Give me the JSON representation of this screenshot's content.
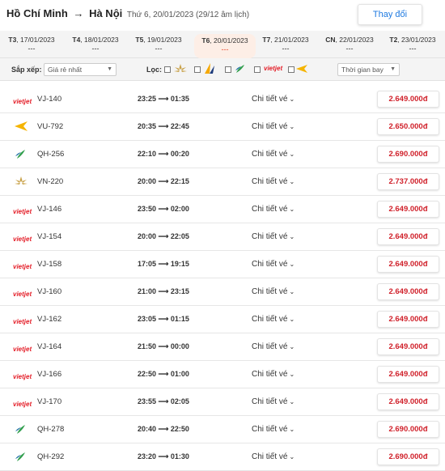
{
  "header": {
    "origin": "Hồ Chí Minh",
    "arrow": "→",
    "destination": "Hà Nội",
    "date_text": "Thứ 6, 20/01/2023 (29/12 âm lịch)",
    "change_button": "Thay đổi"
  },
  "days": [
    {
      "dow": "T3",
      "date": ", 17/01/2023",
      "price": "---",
      "active": false
    },
    {
      "dow": "T4",
      "date": ", 18/01/2023",
      "price": "---",
      "active": false
    },
    {
      "dow": "T5",
      "date": ", 19/01/2023",
      "price": "---",
      "active": false
    },
    {
      "dow": "T6",
      "date": ", 20/01/2023",
      "price": "---",
      "active": true
    },
    {
      "dow": "T7",
      "date": ", 21/01/2023",
      "price": "---",
      "active": false
    },
    {
      "dow": "CN",
      "date": ", 22/01/2023",
      "price": "---",
      "active": false
    },
    {
      "dow": "T2",
      "date": ", 23/01/2023",
      "price": "---",
      "active": false
    }
  ],
  "filters": {
    "sort_label": "Sắp xếp:",
    "sort_value": "Giá rẻ nhất",
    "filter_label": "Lọc:",
    "time_value": "Thời gian bay",
    "vietjet_logo_text": "vietjet"
  },
  "detail_label": "Chi tiết vé",
  "flights": [
    {
      "airline": "vietjet",
      "code": "VJ-140",
      "time": "23:25 ⟶ 01:35",
      "price": "2.649.000đ"
    },
    {
      "airline": "vietravel",
      "code": "VU-792",
      "time": "20:35 ⟶ 22:45",
      "price": "2.650.000đ"
    },
    {
      "airline": "bamboo",
      "code": "QH-256",
      "time": "22:10 ⟶ 00:20",
      "price": "2.690.000đ"
    },
    {
      "airline": "vietnam",
      "code": "VN-220",
      "time": "20:00 ⟶ 22:15",
      "price": "2.737.000đ"
    },
    {
      "airline": "vietjet",
      "code": "VJ-146",
      "time": "23:50 ⟶ 02:00",
      "price": "2.649.000đ"
    },
    {
      "airline": "vietjet",
      "code": "VJ-154",
      "time": "20:00 ⟶ 22:05",
      "price": "2.649.000đ"
    },
    {
      "airline": "vietjet",
      "code": "VJ-158",
      "time": "17:05 ⟶ 19:15",
      "price": "2.649.000đ"
    },
    {
      "airline": "vietjet",
      "code": "VJ-160",
      "time": "21:00 ⟶ 23:15",
      "price": "2.649.000đ"
    },
    {
      "airline": "vietjet",
      "code": "VJ-162",
      "time": "23:05 ⟶ 01:15",
      "price": "2.649.000đ"
    },
    {
      "airline": "vietjet",
      "code": "VJ-164",
      "time": "21:50 ⟶ 00:00",
      "price": "2.649.000đ"
    },
    {
      "airline": "vietjet",
      "code": "VJ-166",
      "time": "22:50 ⟶ 01:00",
      "price": "2.649.000đ"
    },
    {
      "airline": "vietjet",
      "code": "VJ-170",
      "time": "23:55 ⟶ 02:05",
      "price": "2.649.000đ"
    },
    {
      "airline": "bamboo",
      "code": "QH-278",
      "time": "20:40 ⟶ 22:50",
      "price": "2.690.000đ"
    },
    {
      "airline": "bamboo",
      "code": "QH-292",
      "time": "23:20 ⟶ 01:30",
      "price": "2.690.000đ"
    }
  ]
}
